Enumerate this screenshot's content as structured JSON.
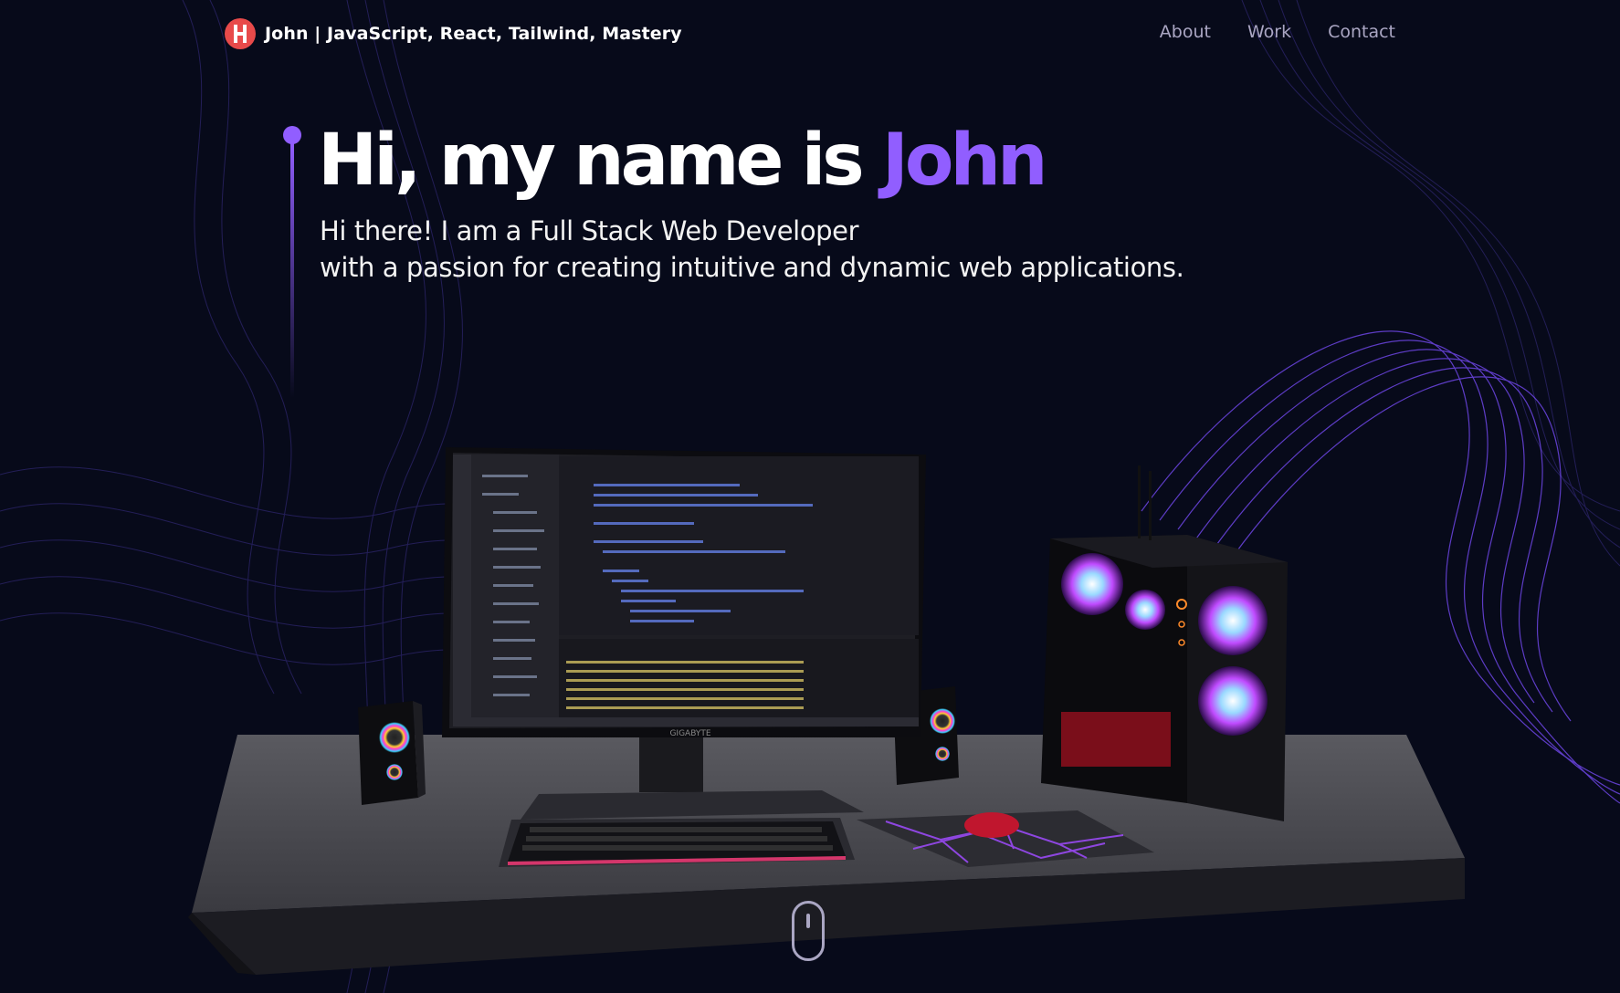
{
  "navbar": {
    "logo_letter": "H",
    "brand": "John  | JavaScript, React, Tailwind, Mastery",
    "links": [
      "About",
      "Work",
      "Contact"
    ]
  },
  "hero": {
    "title_prefix": "Hi, my name is ",
    "title_name": "John",
    "subtitle_line1": "Hi there! I am a Full Stack Web Developer",
    "subtitle_line2": "with a passion for creating intuitive and dynamic web applications."
  },
  "scene": {
    "monitor_brand": "GIGABYTE"
  },
  "colors": {
    "background": "#070a1a",
    "accent": "#915eff",
    "nav_text": "#aaa6c3",
    "logo": "#e84a4a"
  },
  "icons": [
    "logo-icon",
    "scroll-mouse-icon"
  ]
}
